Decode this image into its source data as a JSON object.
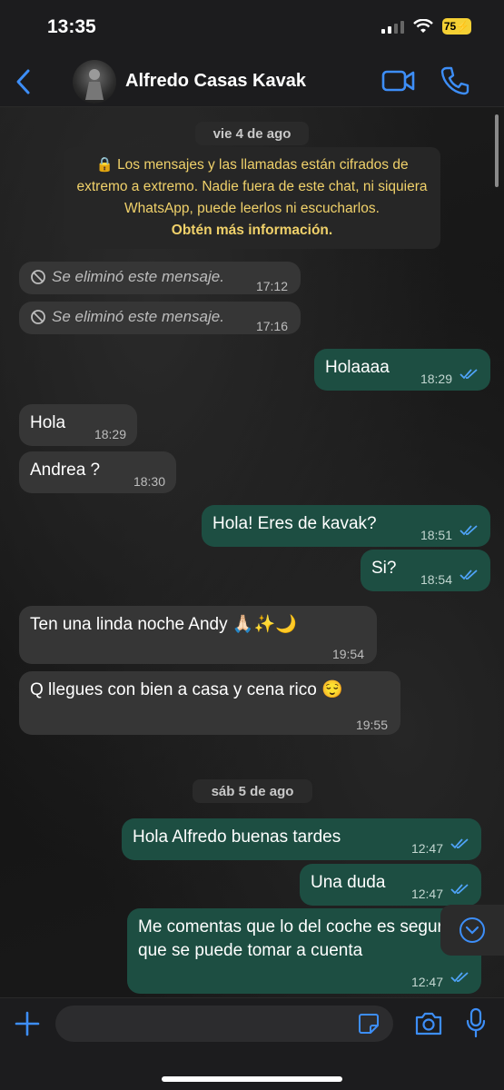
{
  "status_bar": {
    "time": "13:35",
    "battery": "75"
  },
  "header": {
    "contact_name": "Alfredo Casas Kavak"
  },
  "colors": {
    "accent": "#3d8ef8",
    "outgoing_bubble": "#1d4e42",
    "incoming_bubble": "#363636",
    "ticks": "#4fa3f7",
    "notice_text": "#f0d16a"
  },
  "chat": {
    "date_1": "vie 4 de ago",
    "notice": {
      "text": "Los mensajes y las llamadas están cifrados de extremo a extremo. Nadie fuera de este chat, ni siquiera WhatsApp, puede leerlos ni escucharlos.",
      "link": "Obtén más información."
    },
    "messages_day1": [
      {
        "kind": "deleted",
        "text": "Se eliminó este mensaje.",
        "time": "17:12"
      },
      {
        "kind": "deleted",
        "text": "Se eliminó este mensaje.",
        "time": "17:16"
      },
      {
        "kind": "out",
        "text": "Holaaaa",
        "time": "18:29"
      },
      {
        "kind": "in",
        "text": "Hola",
        "time": "18:29"
      },
      {
        "kind": "in",
        "text": "Andrea ?",
        "time": "18:30"
      },
      {
        "kind": "out",
        "text": "Hola! Eres de kavak?",
        "time": "18:51"
      },
      {
        "kind": "out",
        "text": "Si?",
        "time": "18:54"
      },
      {
        "kind": "in",
        "text": "Ten una linda noche Andy 🙏🏻✨🌙",
        "time": "19:54"
      },
      {
        "kind": "in",
        "text": "Q llegues con bien a casa y cena rico 😌",
        "time": "19:55"
      }
    ],
    "date_2": "sáb 5 de ago",
    "messages_day2": [
      {
        "kind": "out",
        "text": "Hola Alfredo buenas tardes",
        "time": "12:47"
      },
      {
        "kind": "out",
        "text": "Una duda",
        "time": "12:47"
      },
      {
        "kind": "out",
        "text": "Me comentas que lo del coche es seguro que se puede tomar a cuenta",
        "time": "12:47"
      }
    ]
  },
  "input": {
    "placeholder": ""
  },
  "icons": [
    "back-icon",
    "video-call-icon",
    "phone-icon",
    "lock-icon",
    "blocked-icon",
    "double-check-icon",
    "chevron-down-icon",
    "plus-icon",
    "sticker-icon",
    "camera-icon",
    "microphone-icon"
  ]
}
